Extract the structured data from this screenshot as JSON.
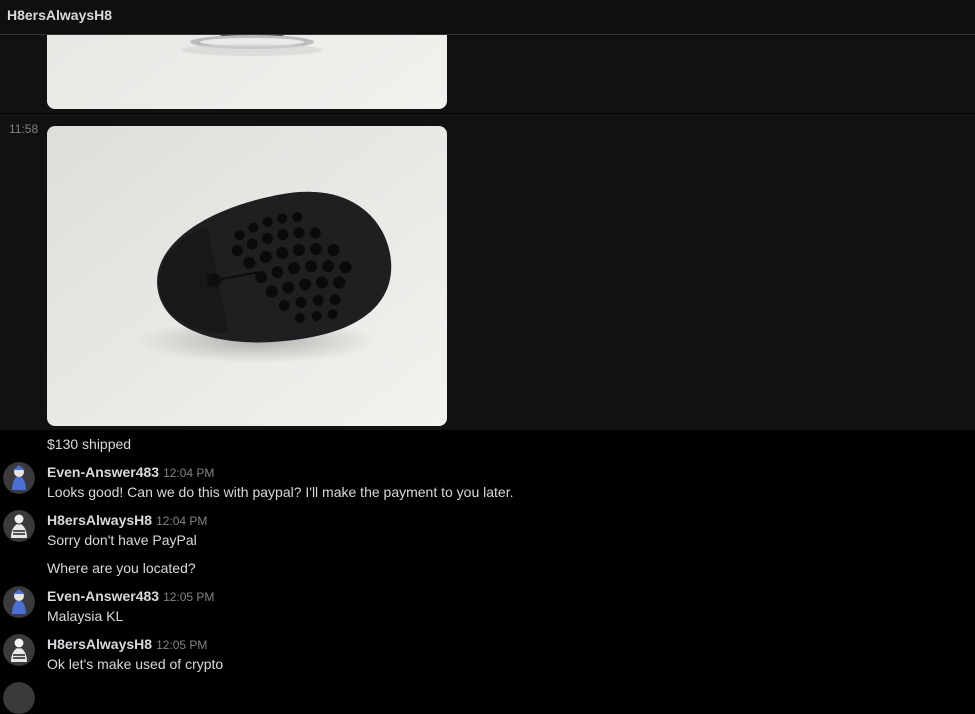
{
  "header": {
    "title": "H8ersAlwaysH8"
  },
  "image_message": {
    "time": "11:58"
  },
  "messages": [
    {
      "kind": "text",
      "text": "$130 shipped"
    },
    {
      "kind": "authored",
      "author": "Even-Answer483",
      "time": "12:04 PM",
      "text": "Looks good! Can we do this with paypal? I'll make the payment to you later."
    },
    {
      "kind": "authored",
      "author": "H8ersAlwaysH8",
      "time": "12:04 PM",
      "text": "Sorry don't have PayPal"
    },
    {
      "kind": "text",
      "text": "Where are you located?"
    },
    {
      "kind": "authored",
      "author": "Even-Answer483",
      "time": "12:05 PM",
      "text": "Malaysia KL"
    },
    {
      "kind": "authored",
      "author": "H8ersAlwaysH8",
      "time": "12:05 PM",
      "text": "Ok let's make used of crypto"
    }
  ],
  "colors": {
    "background": "#000000",
    "image_row": "#111112",
    "text": "#d7dadc",
    "muted": "#818384"
  }
}
